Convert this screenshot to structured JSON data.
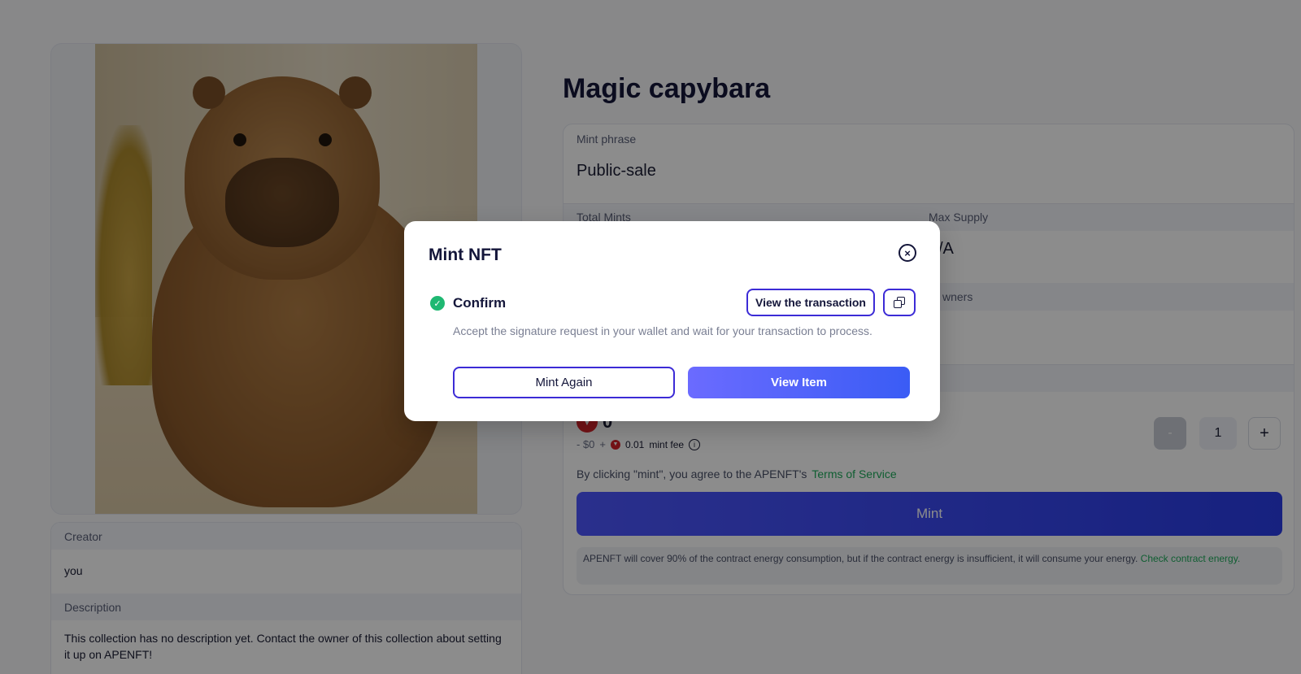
{
  "left": {
    "image_alt": "capybara photo",
    "creator_label": "Creator",
    "creator_value": "you",
    "description_label": "Description",
    "description_value": "This collection has no description yet. Contact the owner of this collection about setting it up on APENFT!"
  },
  "nft": {
    "title": "Magic capybara",
    "mint_phrase_label": "Mint phrase",
    "mint_phrase_value": "Public-sale",
    "total_mints_label": "Total Mints",
    "max_supply_label": "Max Supply",
    "max_supply_value": "/A",
    "owners_label": "wners",
    "price_value": "0",
    "usd_value": "- $0",
    "fee_prefix": "+",
    "fee_amount": "0.01",
    "fee_suffix": "mint fee",
    "info_glyph": "i",
    "minus": "-",
    "quantity": "1",
    "plus": "+",
    "terms_text": "By clicking \"mint\", you agree to the APENFT's",
    "terms_link": "Terms of Service",
    "mint_button": "Mint",
    "energy_text": "APENFT will cover 90% of the contract energy consumption, but if the contract energy is insufficient, it will consume your energy.",
    "energy_link": "Check contract energy."
  },
  "modal": {
    "title": "Mint NFT",
    "close_glyph": "×",
    "check_glyph": "✓",
    "step_label": "Confirm",
    "step_description": "Accept the signature request in your wallet and wait for your transaction to process.",
    "view_transaction": "View the transaction",
    "mint_again": "Mint Again",
    "view_item": "View Item"
  },
  "icons": {
    "close": "close-icon",
    "check": "check-circle-icon",
    "copy": "copy-icon",
    "trx": "trx-icon",
    "info": "info-icon"
  },
  "colors": {
    "accent": "#3c2bd6",
    "success": "#1fb872",
    "link_green": "#1eab5b",
    "trx_red": "#d6242a"
  }
}
